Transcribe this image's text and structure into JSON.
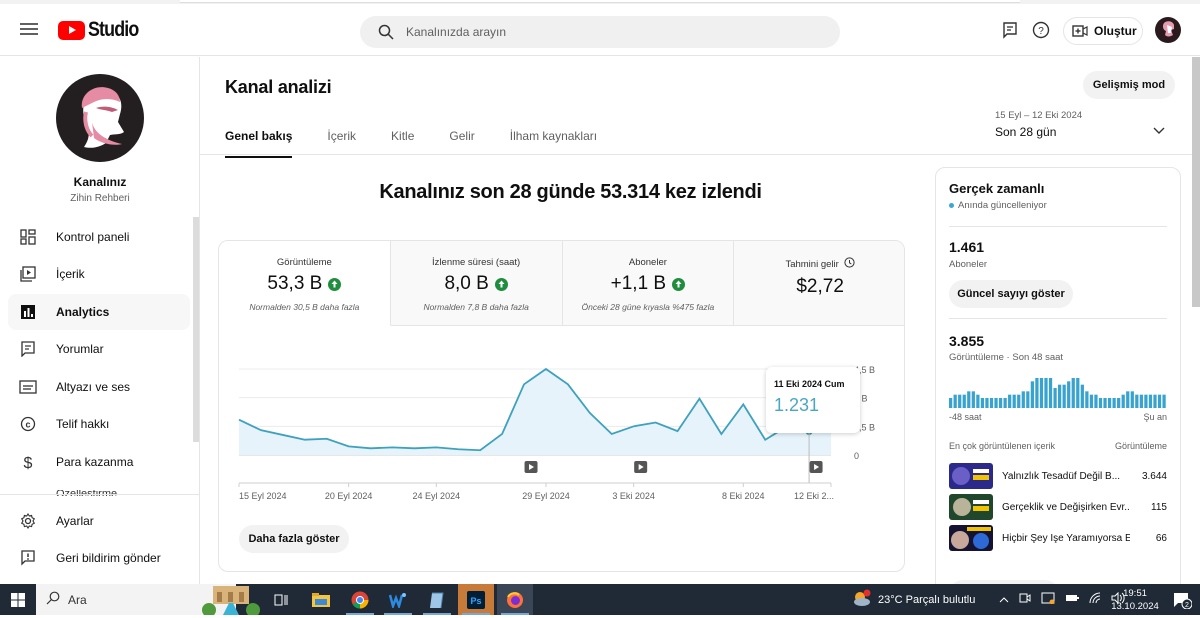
{
  "header": {
    "logo_text": "Studio",
    "search_placeholder": "Kanalınızda arayın",
    "create_label": "Oluştur"
  },
  "sidebar": {
    "channel_title": "Kanalınız",
    "channel_name": "Zihin Rehberi",
    "items": [
      {
        "label": "Kontrol paneli",
        "icon": "dashboard-icon"
      },
      {
        "label": "İçerik",
        "icon": "content-icon"
      },
      {
        "label": "Analytics",
        "icon": "analytics-icon",
        "active": true
      },
      {
        "label": "Yorumlar",
        "icon": "comments-icon"
      },
      {
        "label": "Altyazı ve ses",
        "icon": "subtitles-icon"
      },
      {
        "label": "Telif hakkı",
        "icon": "copyright-icon"
      },
      {
        "label": "Para kazanma",
        "icon": "dollar-icon"
      },
      {
        "label": "Özelleştirme",
        "icon": "customization-icon"
      }
    ],
    "bottom_items": [
      {
        "label": "Ayarlar",
        "icon": "gear-icon"
      },
      {
        "label": "Geri bildirim gönder",
        "icon": "feedback-icon"
      }
    ]
  },
  "main": {
    "page_title": "Kanal analizi",
    "advanced_mode_label": "Gelişmiş mod",
    "tabs": [
      {
        "label": "Genel bakış",
        "active": true
      },
      {
        "label": "İçerik"
      },
      {
        "label": "Kitle"
      },
      {
        "label": "Gelir"
      },
      {
        "label": "İlham kaynakları"
      }
    ],
    "date_range": {
      "dates": "15 Eyl – 12 Eki 2024",
      "label": "Son 28 gün"
    },
    "headline": "Kanalınız son 28 günde 53.314 kez izlendi",
    "metrics": [
      {
        "label": "Görüntüleme",
        "value": "53,3 B",
        "trend": "up",
        "sub": "Normalden 30,5 B daha fazla"
      },
      {
        "label": "İzlenme süresi (saat)",
        "value": "8,0 B",
        "trend": "up",
        "sub": "Normalden 7,8 B daha fazla"
      },
      {
        "label": "Aboneler",
        "value": "+1,1 B",
        "trend": "up",
        "sub": "Önceki 28 güne kıyasla %475 fazla"
      },
      {
        "label": "Tahmini gelir",
        "value": "$2,72",
        "trend": null,
        "sub": ""
      }
    ],
    "show_more_label": "Daha fazla göster",
    "tooltip": {
      "date": "11 Eki 2024 Cum",
      "value": "1.231"
    }
  },
  "chart_data": {
    "type": "area",
    "title": "Görüntüleme",
    "x": [
      "15 Eyl",
      "16 Eyl",
      "17 Eyl",
      "18 Eyl",
      "19 Eyl",
      "20 Eyl",
      "21 Eyl",
      "22 Eyl",
      "23 Eyl",
      "24 Eyl",
      "25 Eyl",
      "26 Eyl",
      "27 Eyl",
      "28 Eyl",
      "29 Eyl",
      "30 Eyl",
      "1 Eki",
      "2 Eki",
      "3 Eki",
      "4 Eki",
      "5 Eki",
      "6 Eki",
      "7 Eki",
      "8 Eki",
      "9 Eki",
      "10 Eki",
      "11 Eki",
      "12 Eki"
    ],
    "values": [
      1850,
      1300,
      1050,
      800,
      850,
      450,
      350,
      400,
      350,
      400,
      300,
      250,
      1100,
      3700,
      5300,
      3700,
      2200,
      1100,
      1500,
      1700,
      1250,
      2950,
      1100,
      2650,
      800,
      1500,
      1231,
      1900
    ],
    "xticks": [
      "15 Eyl 2024",
      "20 Eyl 2024",
      "24 Eyl 2024",
      "29 Eyl 2024",
      "3 Eki 2024",
      "8 Eki 2024",
      "12 Eki 2..."
    ],
    "xtick_index": [
      0,
      5,
      9,
      14,
      18,
      23,
      27
    ],
    "yticks": [
      "0",
      "1,5 B",
      "3 B",
      "4,5 B"
    ],
    "ylim": [
      0,
      4500
    ],
    "video_markers_index": [
      13,
      18,
      26
    ],
    "highlight_index": 26
  },
  "realtime": {
    "title": "Gerçek zamanlı",
    "status": "Anında güncelleniyor",
    "subscribers": "1.461",
    "subscribers_label": "Aboneler",
    "show_count_label": "Güncel sayıyı göster",
    "views": "3.855",
    "views_label": "Görüntüleme · Son 48 saat",
    "hourly_bars": [
      3,
      4,
      4,
      4,
      5,
      5,
      4,
      3,
      3,
      3,
      3,
      3,
      3,
      4,
      4,
      4,
      5,
      5,
      8,
      9,
      9,
      9,
      9,
      6,
      7,
      7,
      8,
      9,
      9,
      7,
      5,
      4,
      4,
      3,
      3,
      3,
      3,
      3,
      4,
      5,
      5,
      4,
      4,
      4,
      4,
      4,
      4,
      4
    ],
    "axis_start": "-48 saat",
    "axis_end": "Şu an",
    "top_content_label": "En çok görüntülenen içerik",
    "top_content_metric": "Görüntüleme",
    "top_videos": [
      {
        "title": "Yalnızlık Tesadüf Değil B...",
        "views": "3.644"
      },
      {
        "title": "Gerçeklik ve Değişirken Evr...",
        "views": "115"
      },
      {
        "title": "Hiçbir Şey İşe Yaramıyorsa E...",
        "views": "66"
      }
    ]
  },
  "taskbar": {
    "search_label": "Ara",
    "weather": "23°C  Parçalı bulutlu",
    "time": "19:51",
    "date": "13.10.2024",
    "notifications": "2"
  }
}
